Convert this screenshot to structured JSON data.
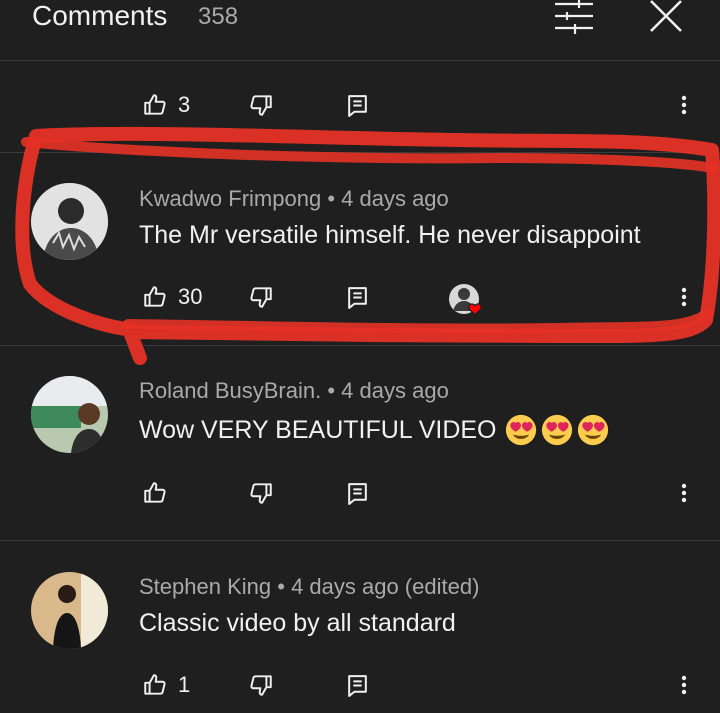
{
  "header": {
    "title": "Comments",
    "count": "358"
  },
  "icons": {
    "filter": "sliders-icon",
    "close": "close-icon",
    "like": "thumbs-up-icon",
    "dislike": "thumbs-down-icon",
    "reply": "reply-icon",
    "more": "vertical-dots-icon",
    "heart": "creator-heart-icon",
    "emoji": "heart-eyes-emoji"
  },
  "colors": {
    "background": "#1f1f1f",
    "text": "#f1f1f1",
    "meta": "#aaaaaa",
    "marker": "#e53226"
  },
  "top_partial": {
    "likes": "3"
  },
  "comments": [
    {
      "author": "Kwadwo Frimpong",
      "time": "4 days ago",
      "text": "The Mr versatile himself. He never disappoint",
      "likes": "30",
      "hearted": true
    },
    {
      "author": "Roland BusyBrain.",
      "time": "4 days ago",
      "text": "Wow VERY BEAUTIFUL VIDEO",
      "likes": "",
      "emojis": [
        "😍",
        "😍",
        "😍"
      ]
    },
    {
      "author": "Stephen King",
      "time": "4 days ago (edited)",
      "text": "Classic video by all standard",
      "likes": "1"
    }
  ]
}
